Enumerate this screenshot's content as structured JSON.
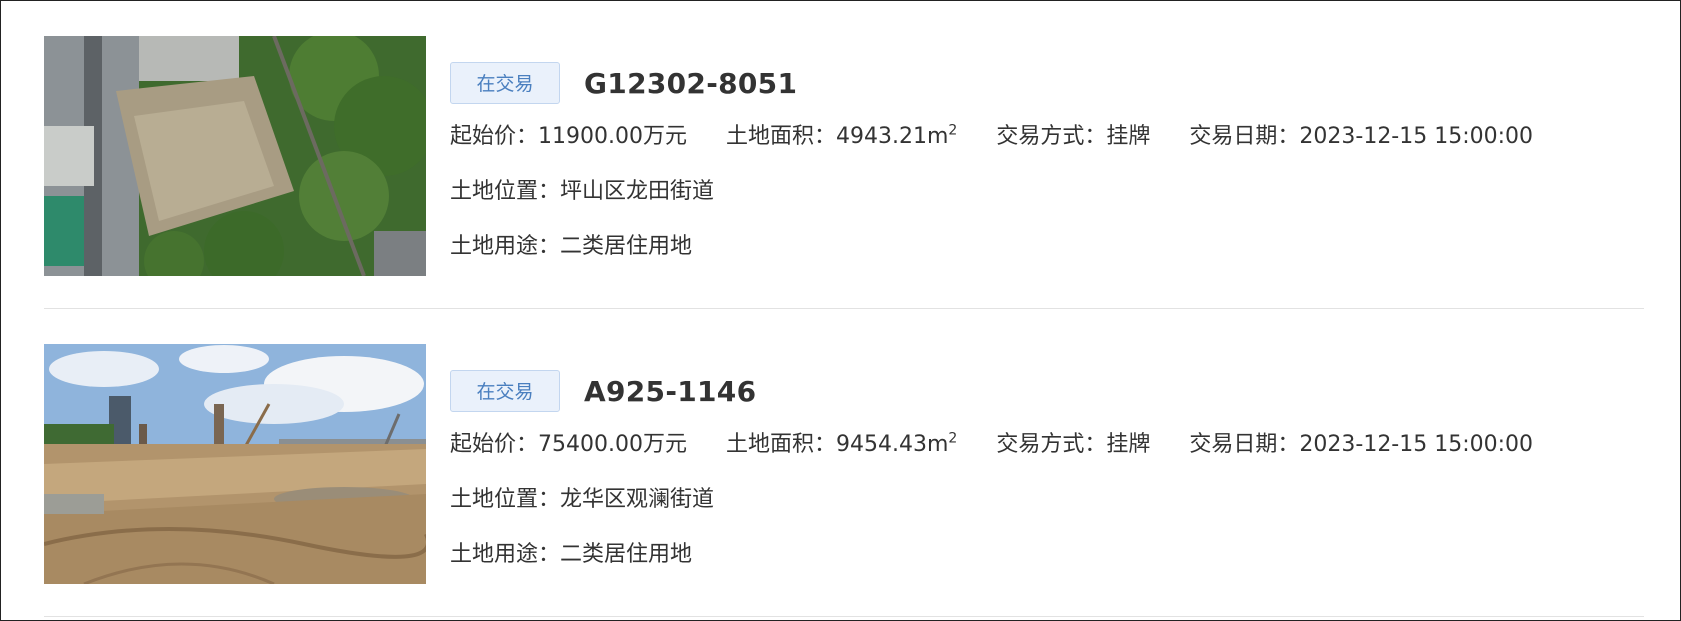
{
  "listings": [
    {
      "status_badge": "在交易",
      "code": "G12302-8051",
      "start_price_label": "起始价：",
      "start_price": "11900.00万元",
      "area_label": "土地面积：",
      "area_value": "4943.21m",
      "area_unit_sup": "2",
      "method_label": "交易方式：",
      "method": "挂牌",
      "date_label": "交易日期：",
      "date": "2023-12-15 15:00:00",
      "location_label": "土地位置：",
      "location": "坪山区龙田街道",
      "usage_label": "土地用途：",
      "usage": "二类居住用地"
    },
    {
      "status_badge": "在交易",
      "code": "A925-1146",
      "start_price_label": "起始价：",
      "start_price": "75400.00万元",
      "area_label": "土地面积：",
      "area_value": "9454.43m",
      "area_unit_sup": "2",
      "method_label": "交易方式：",
      "method": "挂牌",
      "date_label": "交易日期：",
      "date": "2023-12-15 15:00:00",
      "location_label": "土地位置：",
      "location": "龙华区观澜街道",
      "usage_label": "土地用途：",
      "usage": "二类居住用地"
    }
  ],
  "colors": {
    "badge_text": "#4a7fbf",
    "badge_bg": "#eaf1fb",
    "text": "#333333",
    "divider": "#e2e2e2"
  }
}
